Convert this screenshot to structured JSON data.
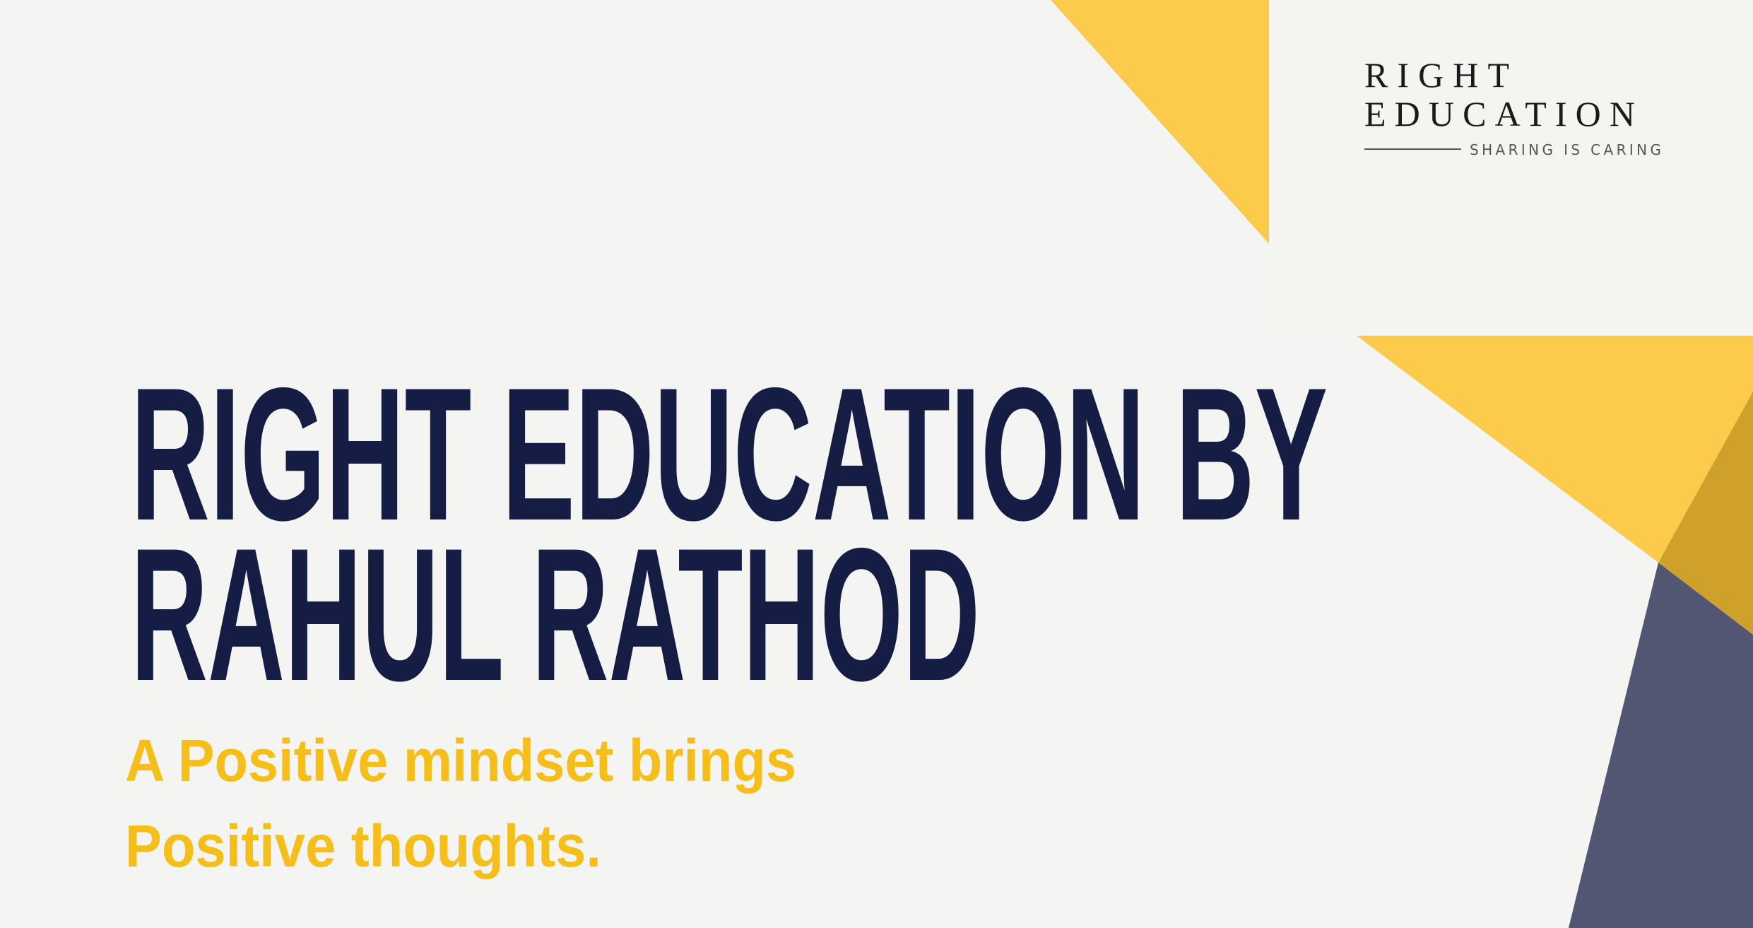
{
  "colors": {
    "background": "#f4f4f3",
    "panel": "#f4f4f0",
    "yellow": "#fccb4c",
    "dark_gold": "#cfa12b",
    "slate": "#525672",
    "navy": "#161d45",
    "accent_text": "#f6be1a"
  },
  "logo": {
    "line1": "RIGHT",
    "line2": "EDUCATION",
    "tagline": "SHARING IS CARING"
  },
  "headline": {
    "line1": "RIGHT EDUCATION BY",
    "line2": "RAHUL RATHOD"
  },
  "subtitle": {
    "line1": "A Positive mindset brings",
    "line2": "Positive thoughts."
  }
}
